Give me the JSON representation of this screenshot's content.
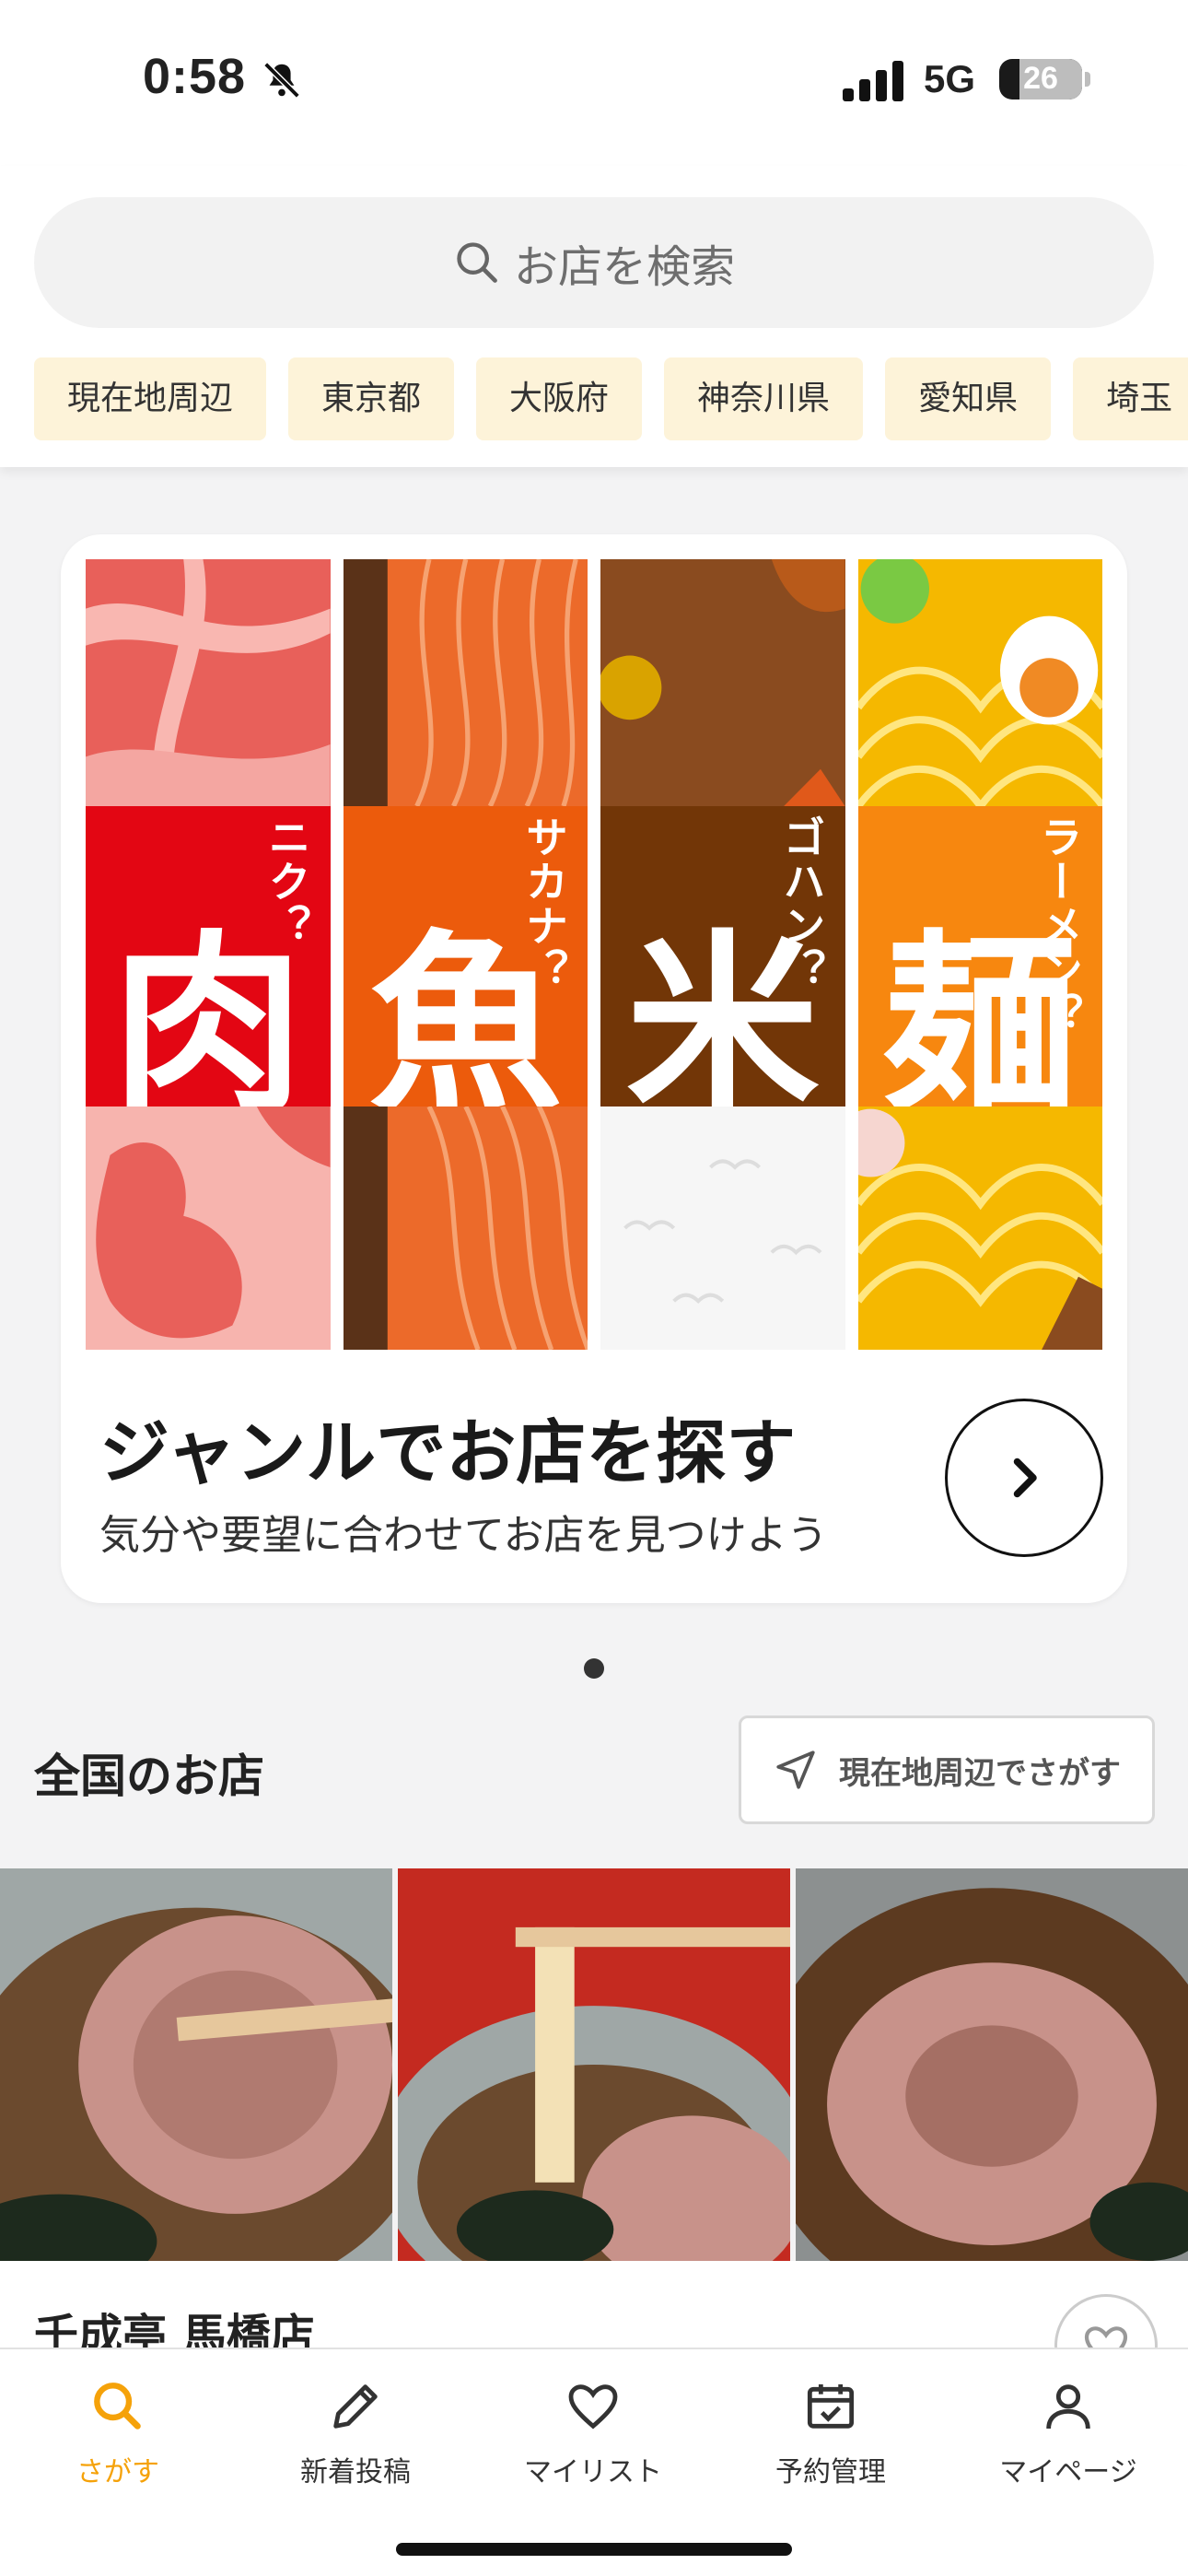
{
  "status": {
    "time": "0:58",
    "network": "5G",
    "battery": "26"
  },
  "search": {
    "placeholder": "お店を検索"
  },
  "chips": [
    "現在地周辺",
    "東京都",
    "大阪府",
    "神奈川県",
    "愛知県",
    "埼玉"
  ],
  "genre_card": {
    "genres": [
      {
        "kanji": "肉",
        "reading": "ニク？",
        "color": "#e30613"
      },
      {
        "kanji": "魚",
        "reading": "サカナ？",
        "color": "#ec5b0c"
      },
      {
        "kanji": "米",
        "reading": "ゴハン？",
        "color": "#723607"
      },
      {
        "kanji": "麺",
        "reading": "ラーメン？",
        "color": "#f7870f"
      }
    ],
    "title": "ジャンルでお店を探す",
    "subtitle": "気分や要望に合わせてお店を見つけよう"
  },
  "section": {
    "title": "全国のお店",
    "near_button": "現在地周辺でさがす"
  },
  "shop": {
    "name": "千成亭 馬橋店"
  },
  "tabs": [
    {
      "label": "さがす",
      "icon": "search-icon",
      "active": true
    },
    {
      "label": "新着投稿",
      "icon": "pencil-icon",
      "active": false
    },
    {
      "label": "マイリスト",
      "icon": "heart-icon",
      "active": false
    },
    {
      "label": "予約管理",
      "icon": "calendar-check-icon",
      "active": false
    },
    {
      "label": "マイページ",
      "icon": "person-icon",
      "active": false
    }
  ],
  "colors": {
    "accent": "#f5a20a",
    "chip_bg": "#fdf3d9"
  }
}
